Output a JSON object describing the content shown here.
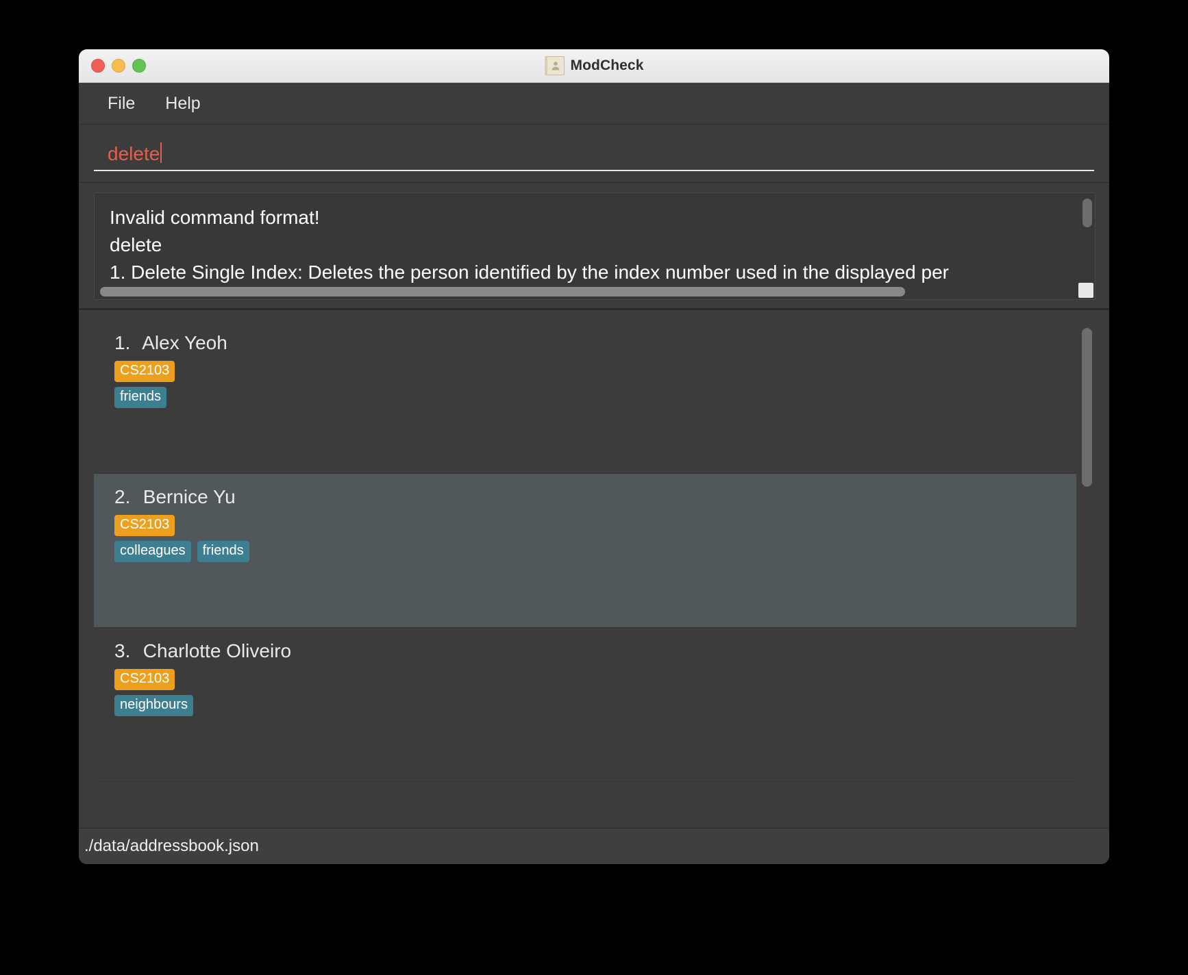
{
  "window": {
    "title": "ModCheck",
    "icon": "address-book-icon",
    "traffic_lights": [
      "close",
      "minimize",
      "maximize"
    ]
  },
  "menubar": {
    "items": [
      {
        "label": "File"
      },
      {
        "label": "Help"
      }
    ]
  },
  "command": {
    "value": "delete",
    "placeholder": "Enter command here...",
    "text_color": "#e0624e"
  },
  "result": {
    "lines": [
      "Invalid command format!",
      "delete",
      "1. Delete Single Index: Deletes the person identified by the index number used in the displayed per"
    ]
  },
  "person_list": {
    "people": [
      {
        "index": "1.",
        "name": "Alex Yeoh",
        "modules": [
          "CS2103"
        ],
        "tags": [
          "friends"
        ],
        "selected": false
      },
      {
        "index": "2.",
        "name": "Bernice Yu",
        "modules": [
          "CS2103"
        ],
        "tags": [
          "colleagues",
          "friends"
        ],
        "selected": true
      },
      {
        "index": "3.",
        "name": "Charlotte Oliveiro",
        "modules": [
          "CS2103"
        ],
        "tags": [
          "neighbours"
        ],
        "selected": false
      }
    ]
  },
  "statusbar": {
    "save_location": "./data/addressbook.json"
  },
  "colors": {
    "module_tag": "#eda01e",
    "label_tag": "#3d7f90",
    "error_text": "#e0624e",
    "selected_row": "#51585c",
    "panel_bg": "#3c3c3c"
  }
}
